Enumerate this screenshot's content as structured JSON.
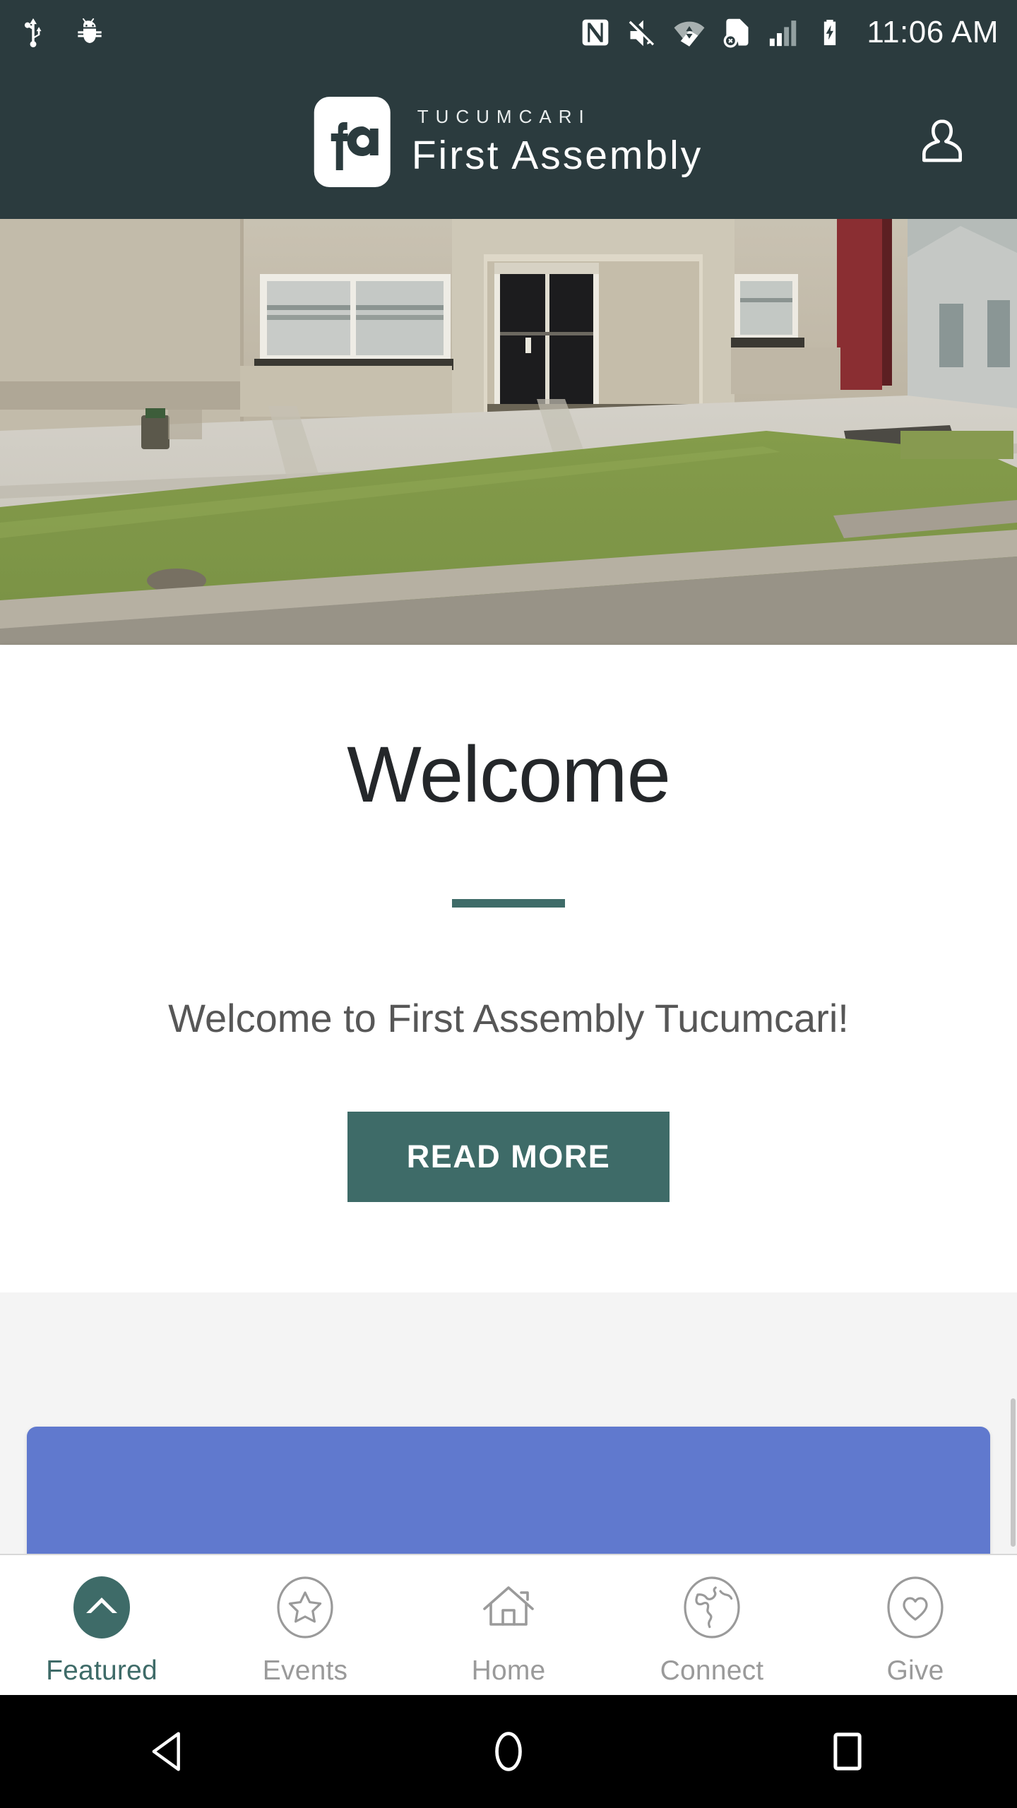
{
  "status_bar": {
    "time": "11:06 AM",
    "left_icons": [
      "usb-icon",
      "android-debug-bug-icon"
    ],
    "right_icons": [
      "nfc-icon",
      "volume-muted-icon",
      "wifi-icon",
      "sim-card-error-icon",
      "cellular-signal-icon",
      "battery-charging-icon"
    ],
    "background_color": "#2b3b3e"
  },
  "header": {
    "logo_text": "fa",
    "superline": "TUCUMCARI",
    "title": "First Assembly",
    "profile_icon": "person-icon",
    "background_color": "#2b3b3e"
  },
  "hero": {
    "alt": "Church building exterior with glass entry doors, sidewalk and lawn"
  },
  "welcome": {
    "heading": "Welcome",
    "body": "Welcome to First Assembly Tucumcari!",
    "button_label": "READ MORE",
    "accent_color": "#3e6b68"
  },
  "feed": {
    "card_color": "#6079ce",
    "background_color": "#f4f4f4"
  },
  "tabbar": {
    "items": [
      {
        "label": "Featured",
        "icon": "chevron-up-circle-icon",
        "active": true
      },
      {
        "label": "Events",
        "icon": "star-circle-icon",
        "active": false
      },
      {
        "label": "Home",
        "icon": "house-icon",
        "active": false
      },
      {
        "label": "Connect",
        "icon": "globe-circle-icon",
        "active": false
      },
      {
        "label": "Give",
        "icon": "heart-circle-icon",
        "active": false
      }
    ],
    "active_color": "#3e6b68",
    "inactive_color": "#9a9a9a"
  },
  "android_nav": {
    "buttons": [
      "back-triangle-icon",
      "home-circle-icon",
      "recents-square-icon"
    ]
  }
}
